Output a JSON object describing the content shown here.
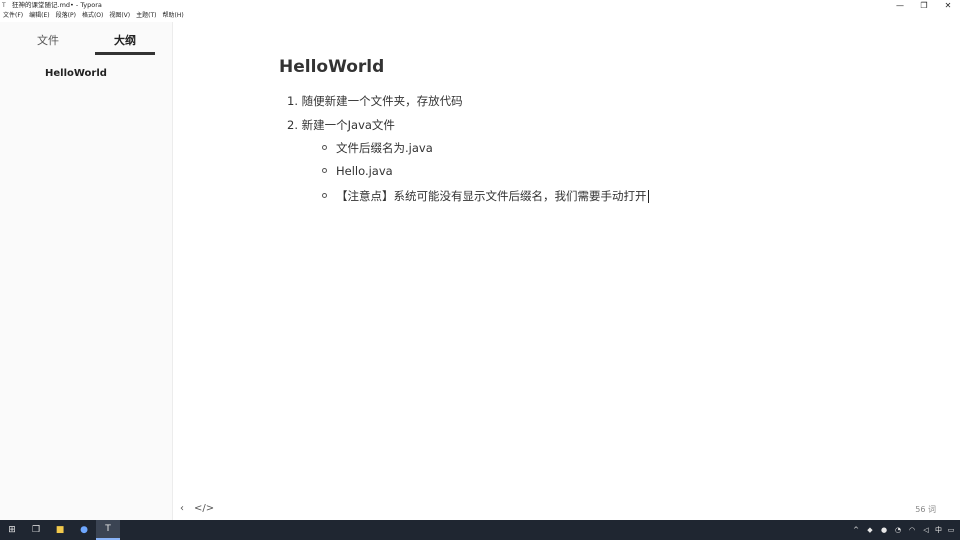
{
  "window": {
    "title": "狂神的课堂随记.md• - Typora",
    "controls": {
      "minimize": "—",
      "restore": "❐",
      "close": "✕"
    }
  },
  "menubar": {
    "items": [
      "文件(F)",
      "编辑(E)",
      "段落(P)",
      "格式(O)",
      "视图(V)",
      "主题(T)",
      "帮助(H)"
    ]
  },
  "sidebar": {
    "tabs": {
      "files": "文件",
      "outline": "大纲"
    },
    "outline_items": [
      "HelloWorld"
    ]
  },
  "document": {
    "heading": "HelloWorld",
    "ordered": [
      {
        "num": "1.",
        "text": "随便新建一个文件夹，存放代码"
      },
      {
        "num": "2.",
        "text": "新建一个Java文件"
      }
    ],
    "bullets": [
      "文件后缀名为.java",
      "Hello.java",
      "【注意点】系统可能没有显示文件后缀名，我们需要手动打开"
    ]
  },
  "footer": {
    "back": "‹",
    "source": "</>",
    "words": "56 词"
  },
  "taskbar": {
    "tray_lang": "中"
  },
  "colors": {
    "taskbar_bg": "#1f2631",
    "sidebar_bg": "#fafafa",
    "text": "#333333"
  }
}
